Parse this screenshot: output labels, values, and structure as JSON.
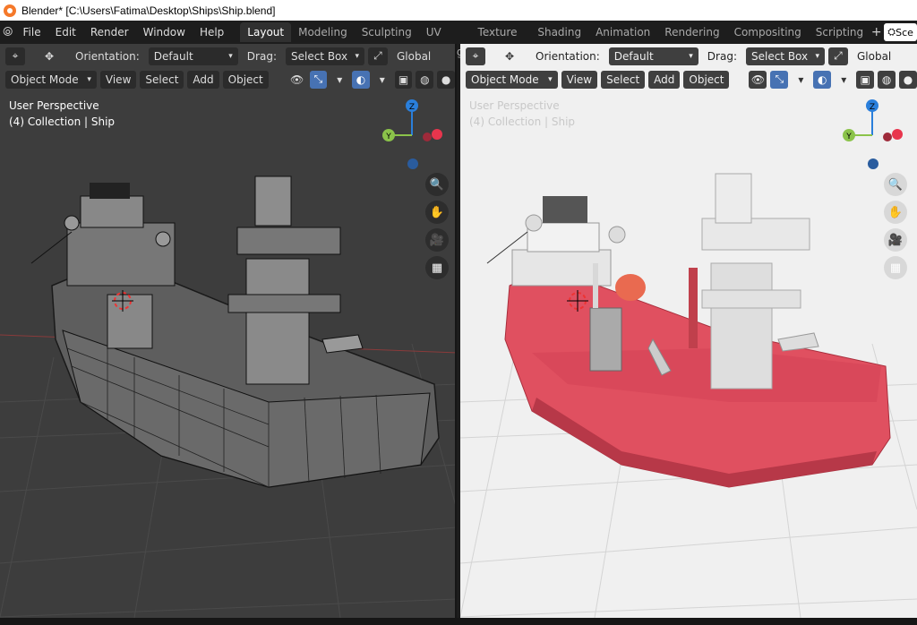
{
  "window": {
    "title": "Blender* [C:\\Users\\Fatima\\Desktop\\Ships\\Ship.blend]"
  },
  "menu": [
    "File",
    "Edit",
    "Render",
    "Window",
    "Help"
  ],
  "workspace_tabs": [
    "Layout",
    "Modeling",
    "Sculpting",
    "UV Editing",
    "Texture Paint",
    "Shading",
    "Animation",
    "Rendering",
    "Compositing",
    "Scripting"
  ],
  "active_tab": "Layout",
  "scene_selector": "Sce",
  "viewport_header": {
    "orientation_label": "Orientation:",
    "orientation_value": "Default",
    "drag_label": "Drag:",
    "drag_value": "Select Box",
    "transform_space": "Global",
    "mode": "Object Mode",
    "view": "View",
    "select": "Select",
    "add": "Add",
    "object": "Object"
  },
  "viewports": {
    "left": {
      "perspective": "User Perspective",
      "collection": "(4) Collection | Ship",
      "shading": "wireframe"
    },
    "right": {
      "perspective": "User Perspective",
      "collection": "(4) Collection | Ship",
      "shading": "solid"
    }
  },
  "gizmo": {
    "z": "Z",
    "y": "Y",
    "x_color": "#e8354d",
    "y_color": "#8bc34a",
    "z_color": "#2a7fdb"
  },
  "colors": {
    "hull_red": "#e05060",
    "active_tab_bg": "#303030",
    "toggle_blue": "#4772b3"
  }
}
